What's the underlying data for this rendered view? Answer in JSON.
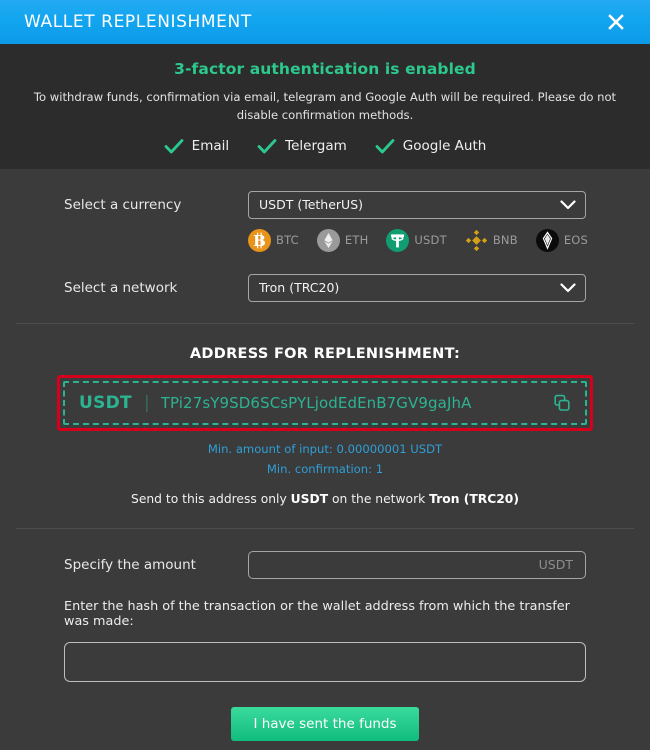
{
  "titlebar": {
    "title": "WALLET REPLENISHMENT",
    "close_icon": "close-x-icon",
    "accent_color": "#12a5f0"
  },
  "auth_banner": {
    "title": "3-factor authentication is enabled",
    "description": "To withdraw funds, confirmation via email, telegram and Google Auth will be required. Please do not disable confirmation methods.",
    "accent_color": "#2cc98e",
    "methods": [
      {
        "label": "Email",
        "icon": "check-icon"
      },
      {
        "label": "Telergam",
        "icon": "check-icon"
      },
      {
        "label": "Google Auth",
        "icon": "check-icon"
      }
    ]
  },
  "currency": {
    "label": "Select a currency",
    "selected": "USDT (TetherUS)",
    "chevron_icon": "chevron-down-icon",
    "coins": [
      {
        "symbol": "BTC",
        "color": "#e8941a"
      },
      {
        "symbol": "ETH",
        "color": "#9a9a9a"
      },
      {
        "symbol": "USDT",
        "color": "#0f9d71"
      },
      {
        "symbol": "BNB",
        "color": "#d4a017"
      },
      {
        "symbol": "EOS",
        "color": "#000000"
      }
    ]
  },
  "network": {
    "label": "Select a network",
    "selected": "Tron (TRC20)",
    "chevron_icon": "chevron-down-icon"
  },
  "address": {
    "title": "ADDRESS FOR REPLENISHMENT:",
    "ticker": "USDT",
    "separator": "|",
    "value": "TPi27sY9SD6SCsPYLjodEdEnB7GV9gaJhA",
    "copy_icon": "copy-icon",
    "highlight_color": "#d6001c",
    "text_color": "#2cb391",
    "min_amount": "Min. amount of input: 0.00000001 USDT",
    "min_confirmation": "Min. confirmation: 1",
    "info_color": "#2f9fd6",
    "send_note_prefix": "Send to this address only ",
    "send_note_currency": "USDT",
    "send_note_middle": " on the network ",
    "send_note_network": "Tron (TRC20)"
  },
  "amount": {
    "label": "Specify the amount",
    "value": "",
    "placeholder": "USDT"
  },
  "hash": {
    "label": "Enter the hash of the transaction or the wallet address from which the transfer was made:",
    "value": "",
    "placeholder": ""
  },
  "submit": {
    "label": "I have sent the funds",
    "color": "#24c98c"
  }
}
